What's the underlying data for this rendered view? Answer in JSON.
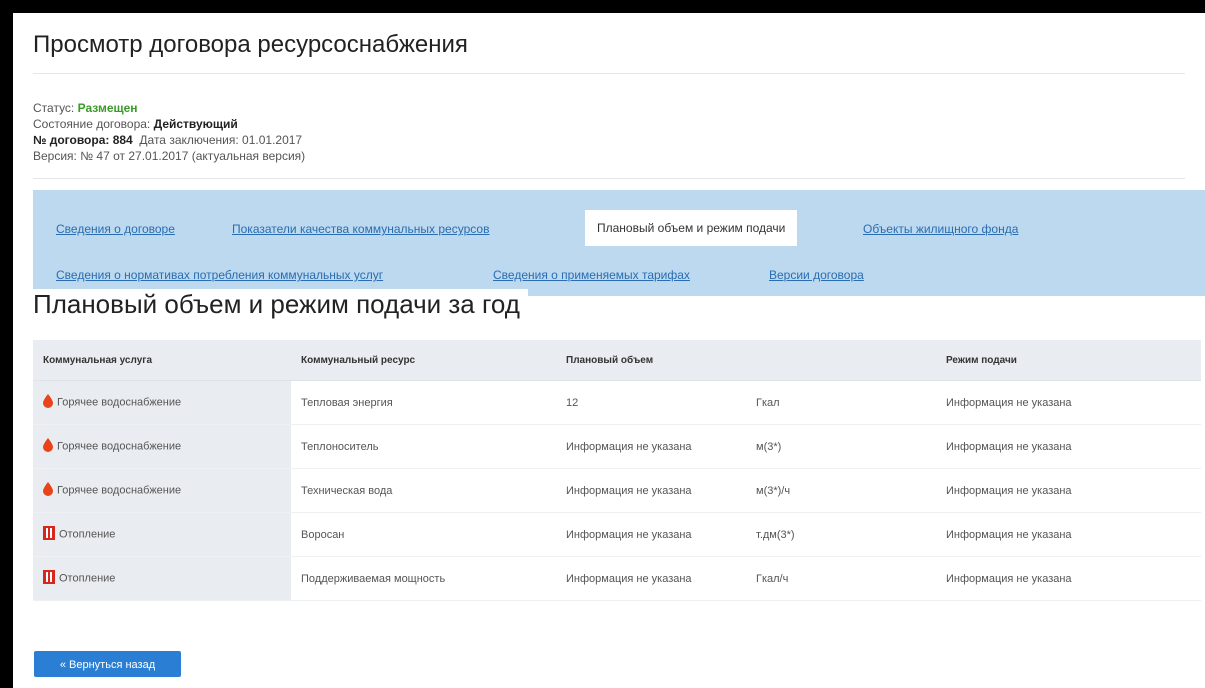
{
  "page": {
    "title": "Просмотр договора ресурсоснабжения"
  },
  "info": {
    "status_label": "Статус:",
    "status_value": "Размещен",
    "state_label": "Состояние договора:",
    "state_value": "Действующий",
    "number_label": "№ договора: 884",
    "date_label": "Дата заключения:",
    "date_value": "01.01.2017",
    "version_text": "Версия: № 47 от 27.01.2017 (актуальная версия)"
  },
  "tabs": [
    {
      "label": "Сведения о договоре",
      "active": false
    },
    {
      "label": "Показатели качества коммунальных ресурсов",
      "active": false
    },
    {
      "label": "Плановый объем и режим подачи",
      "active": true
    },
    {
      "label": "Объекты жилищного фонда",
      "active": false
    },
    {
      "label": "Сведения о нормативах потребления коммунальных услуг",
      "active": false
    },
    {
      "label": "Сведения о применяемых тарифах",
      "active": false
    },
    {
      "label": "Версии договора",
      "active": false
    }
  ],
  "section": {
    "title": "Плановый объем и режим подачи за год"
  },
  "table": {
    "headers": [
      "Коммунальная услуга",
      "Коммунальный ресурс",
      "Плановый объем",
      "",
      "Режим подачи"
    ],
    "rows": [
      {
        "service": "Горячее водоснабжение",
        "icon": "water-drop-icon",
        "resource": "Тепловая энергия",
        "volume": "12",
        "unit": "Гкал",
        "mode": "Информация не указана"
      },
      {
        "service": "Горячее водоснабжение",
        "icon": "water-drop-icon",
        "resource": "Теплоноситель",
        "volume": "Информация не указана",
        "unit": "м(3*)",
        "mode": "Информация не указана"
      },
      {
        "service": "Горячее водоснабжение",
        "icon": "water-drop-icon",
        "resource": "Техническая вода",
        "volume": "Информация не указана",
        "unit": "м(3*)/ч",
        "mode": "Информация не указана"
      },
      {
        "service": "Отопление",
        "icon": "radiator-icon",
        "resource": "Воросан",
        "volume": "Информация не указана",
        "unit": "т.дм(3*)",
        "mode": "Информация не указана"
      },
      {
        "service": "Отопление",
        "icon": "radiator-icon",
        "resource": "Поддерживаемая мощность",
        "volume": "Информация не указана",
        "unit": "Гкал/ч",
        "mode": "Информация не указана"
      }
    ]
  },
  "actions": {
    "back_label": "« Вернуться назад"
  },
  "colors": {
    "nav_bg": "#bcd9ef",
    "link": "#2a6db0",
    "status_green": "#3a9a2a",
    "button": "#2a7fd4",
    "water_icon": "#e8431a",
    "radiator_icon": "#d9261c"
  }
}
